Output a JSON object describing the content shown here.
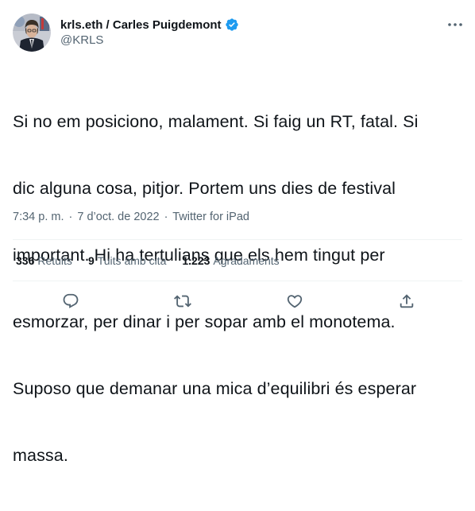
{
  "author": {
    "name": "krls.eth / Carles Puigdemont",
    "handle": "@KRLS",
    "verified_color": "#1d9bf0"
  },
  "menu": {
    "more_icon": "more-horizontal-icon"
  },
  "tweet": {
    "lines": [
      "Si no em posiciono, malament. Si faig un RT, fatal. Si",
      "dic alguna cosa, pitjor. Portem uns dies de festival",
      "important. Hi ha tertulians que els hem tingut per",
      "esmorzar, per dinar i per sopar amb el monotema.",
      "Suposo que demanar una mica d’equilibri és esperar",
      "massa."
    ],
    "time": "7:34 p. m.",
    "separator": "·",
    "date": "7 d’oct. de 2022",
    "source": "Twitter for iPad"
  },
  "stats": {
    "retweets_count": "336",
    "retweets_label": "Retuits",
    "quotes_count": "9",
    "quotes_label": "Tuits amb cita",
    "likes_count": "1.223",
    "likes_label": "Agradaments"
  },
  "actions": {
    "icons": [
      "reply-icon",
      "retweet-icon",
      "like-icon",
      "share-icon"
    ],
    "color": "#536471"
  }
}
